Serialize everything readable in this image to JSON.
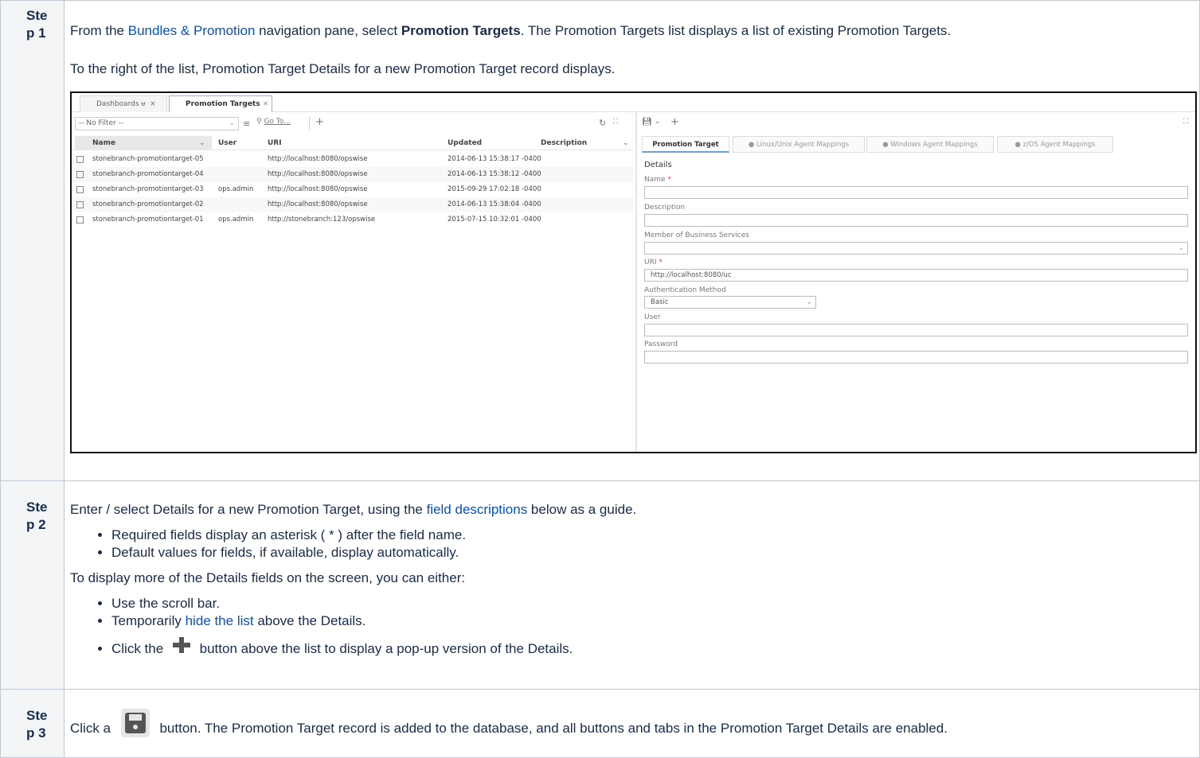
{
  "steps": [
    {
      "label": "Ste p 1",
      "intro_prefix": "From the ",
      "intro_link": "Bundles & Promotion",
      "intro_mid": " navigation pane, select ",
      "intro_bold": "Promotion Targets",
      "intro_suffix": ". The Promotion Targets list displays a list of existing Promotion Targets.",
      "second": "To the right of the list, Promotion Target Details for a new Promotion Target record displays."
    },
    {
      "label": "Ste p 2",
      "intro_prefix": "Enter / select Details for a new Promotion Target, using the ",
      "intro_link": "field descriptions",
      "intro_suffix": " below as a guide.",
      "bullets1": [
        "Required fields display an asterisk ( * ) after the field name.",
        "Default values for fields, if available, display automatically."
      ],
      "mid": "To display more of the Details fields on the screen, you can either:",
      "b2_1": "Use the scroll bar.",
      "b2_2_prefix": "Temporarily ",
      "b2_2_link": "hide the list",
      "b2_2_suffix": " above the Details.",
      "b2_3_prefix": "Click the ",
      "b2_3_suffix": " button above the list to display a pop-up version of the Details."
    },
    {
      "label": "Ste p 3",
      "prefix": "Click a ",
      "suffix": " button. The Promotion Target record is added to the database, and all buttons and tabs in the Promotion Target Details are enabled."
    }
  ],
  "screenshot": {
    "tabs": [
      "Dashboards",
      "Promotion Targets"
    ],
    "tab_pin": "ᵾ",
    "close": "×",
    "filter": "-- No Filter --",
    "goto": "Go To...",
    "plus": "+",
    "columns": [
      "Name",
      "User",
      "URI",
      "Updated",
      "Description"
    ],
    "rows": [
      {
        "name": "stonebranch-promotiontarget-05",
        "user": "",
        "uri": "http://localhost:8080/opswise",
        "updated": "2014-06-13 15:38:17 -0400"
      },
      {
        "name": "stonebranch-promotiontarget-04",
        "user": "",
        "uri": "http://localhost:8080/opswise",
        "updated": "2014-06-13 15:38:12 -0400"
      },
      {
        "name": "stonebranch-promotiontarget-03",
        "user": "ops.admin",
        "uri": "http://localhost:8080/opswise",
        "updated": "2015-09-29 17:02:18 -0400"
      },
      {
        "name": "stonebranch-promotiontarget-02",
        "user": "",
        "uri": "http://localhost:8080/opswise",
        "updated": "2014-06-13 15:38:04 -0400"
      },
      {
        "name": "stonebranch-promotiontarget-01",
        "user": "ops.admin",
        "uri": "http://stonebranch:123/opswise",
        "updated": "2015-07-15 10:32:01 -0400"
      }
    ],
    "detail_tabs": [
      "Promotion Target",
      "Linux/Unix Agent Mappings",
      "Windows Agent Mappings",
      "z/OS Agent Mappings"
    ],
    "details_heading": "Details",
    "fields": {
      "name_label": "Name",
      "description_label": "Description",
      "member_label": "Member of Business Services",
      "uri_label": "URI",
      "uri_value": "http://localhost:8080/uc",
      "auth_label": "Authentication Method",
      "auth_value": "Basic",
      "user_label": "User",
      "password_label": "Password"
    },
    "asterisk": "*"
  }
}
